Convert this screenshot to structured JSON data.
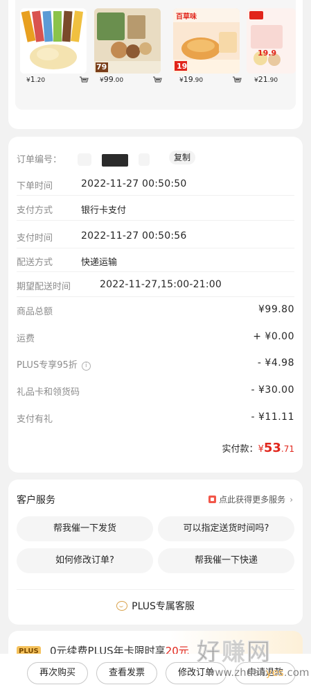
{
  "recommendations": {
    "products": [
      {
        "price_currency": "¥",
        "price_int": "1",
        "price_dec": ".20",
        "image_icon": "ice-cream-product-image"
      },
      {
        "price_currency": "¥",
        "price_int": "99",
        "price_dec": ".00",
        "image_icon": "snack-gift-box-product-image",
        "image_badge": "79"
      },
      {
        "price_currency": "¥",
        "price_int": "19",
        "price_dec": ".90",
        "image_icon": "croissant-product-image",
        "image_badge": "19",
        "brand_text": "百草味"
      },
      {
        "price_currency": "¥",
        "price_int": "21",
        "price_dec": ".90",
        "image_icon": "snack-pack-product-image",
        "image_badge": "19.9"
      }
    ],
    "cart_icon": "cart-icon"
  },
  "order": {
    "order_no_label": "订单编号：",
    "copy_label": "复制",
    "order_time_label": "下单时间",
    "order_time": "2022-11-27 00:50:50",
    "pay_method_label": "支付方式",
    "pay_method": "银行卡支付",
    "pay_time_label": "支付时间",
    "pay_time": "2022-11-27 00:50:56",
    "delivery_label": "配送方式",
    "delivery": "快递运输",
    "expected_label": "期望配送时间",
    "expected": "2022-11-27,15:00-21:00"
  },
  "amounts": {
    "goods_total_label": "商品总额",
    "goods_total": "¥99.80",
    "shipping_label": "运费",
    "shipping": "+ ¥0.00",
    "plus_discount_label": "PLUS专享95折",
    "plus_discount": "- ¥4.98",
    "gift_card_label": "礼品卡和领货码",
    "gift_card": "- ¥30.00",
    "pay_gift_label": "支付有礼",
    "pay_gift": "- ¥11.11",
    "paid_label": "实付款：",
    "paid_currency": "¥",
    "paid_int": "53",
    "paid_dec": ".71",
    "accent_color": "#e1251b"
  },
  "service": {
    "title": "客户服务",
    "more_link": "点此获得更多服务",
    "questions": [
      "帮我催一下发货",
      "可以指定送货时间吗?",
      "如何修改订单?",
      "帮我催一下快递"
    ],
    "plus_service": "PLUS专属客服"
  },
  "plus_banner": {
    "tag": "PLUS",
    "text_prefix": "0元续费PLUS年卡限时享",
    "text_highlight": "20元"
  },
  "bottom_bar": {
    "buttons": [
      "再次购买",
      "查看发票",
      "修改订单",
      "申请退款"
    ]
  },
  "watermark": {
    "logo": "好赚网",
    "url_prefix": "www.zhuan",
    "url_highlight": "yes",
    "url_suffix": ".com"
  }
}
